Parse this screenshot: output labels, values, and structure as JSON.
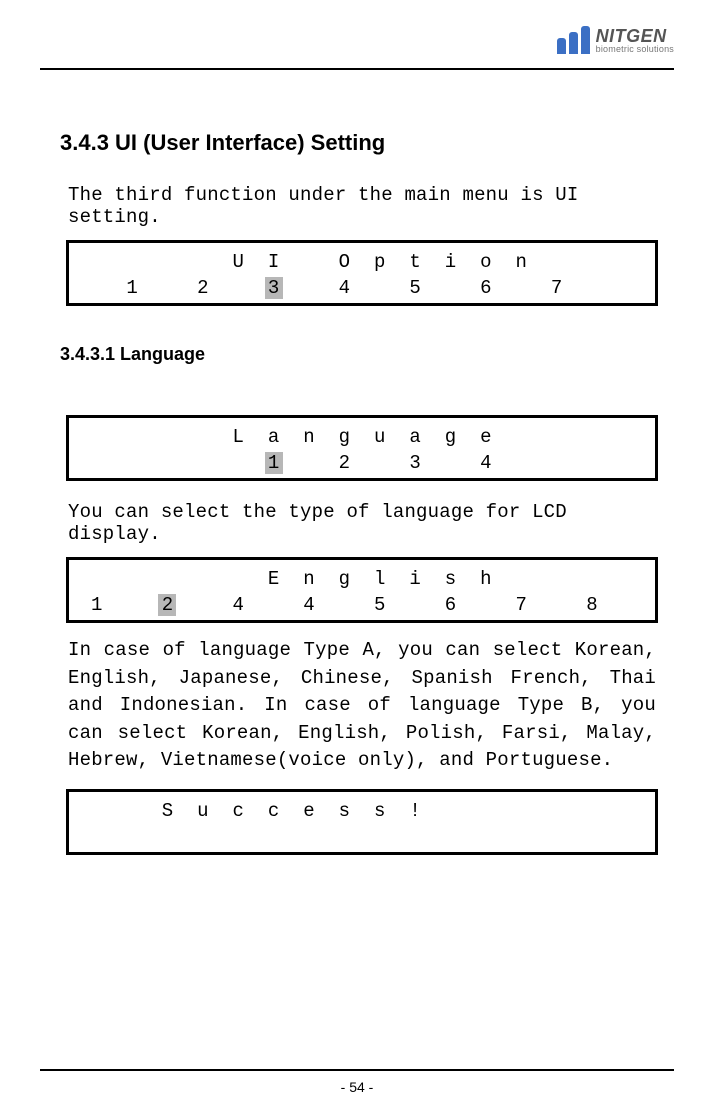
{
  "brand": {
    "name": "NITGEN",
    "tagline": "biometric solutions"
  },
  "section": {
    "heading": "3.4.3 UI (User Interface) Setting",
    "intro": "The third function under the main menu is UI setting."
  },
  "lcd_ui_option": {
    "row1": [
      "",
      "",
      "",
      "",
      "U",
      "I",
      "",
      "O",
      "p",
      "t",
      "i",
      "o",
      "n",
      "",
      "",
      ""
    ],
    "row2": [
      "",
      "1",
      "",
      "2",
      "",
      "3",
      "",
      "4",
      "",
      "5",
      "",
      "6",
      "",
      "7",
      "",
      ""
    ],
    "highlight_r2_index": 5
  },
  "subsection": {
    "heading": "3.4.3.1 Language"
  },
  "lcd_language": {
    "row1": [
      "",
      "",
      "",
      "",
      "L",
      "a",
      "n",
      "g",
      "u",
      "a",
      "g",
      "e",
      "",
      "",
      "",
      ""
    ],
    "row2": [
      "",
      "",
      "",
      "",
      "",
      "1",
      "",
      "2",
      "",
      "3",
      "",
      "4",
      "",
      "",
      "",
      ""
    ],
    "highlight_r2_index": 5
  },
  "language_intro": "You can select the type of language for LCD display.",
  "lcd_english": {
    "row1": [
      "",
      "",
      "",
      "",
      "",
      "E",
      "n",
      "g",
      "l",
      "i",
      "s",
      "h",
      "",
      "",
      "",
      ""
    ],
    "row2": [
      "1",
      "",
      "2",
      "",
      "4",
      "",
      "4",
      "",
      "5",
      "",
      "6",
      "",
      "7",
      "",
      "8",
      ""
    ],
    "highlight_r2_index": 2
  },
  "type_paragraph": "In case of language Type A, you can select Korean, English, Japanese, Chinese, Spanish French, Thai and Indonesian. In case of language Type B, you can select Korean, English, Polish, Farsi, Malay, Hebrew, Vietnamese(voice only), and Portuguese.",
  "lcd_success": {
    "row1": [
      "",
      "",
      "S",
      "u",
      "c",
      "c",
      "e",
      "s",
      "s",
      "!",
      "",
      "",
      "",
      "",
      "",
      ""
    ],
    "row2": [
      "",
      "",
      "",
      "",
      "",
      "",
      "",
      "",
      "",
      "",
      "",
      "",
      "",
      "",
      "",
      ""
    ]
  },
  "page_number": "- 54 -"
}
